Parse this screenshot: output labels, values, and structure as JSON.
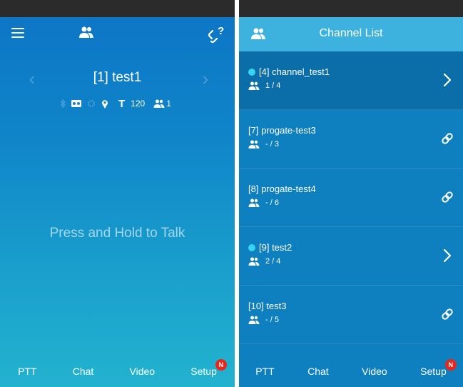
{
  "left_screen": {
    "channel_title": "[1] test1",
    "nav_prev": "‹",
    "nav_next": "›",
    "status": {
      "signal_value": "120",
      "member_count": "1"
    },
    "ptt_prompt": "Press and Hold to Talk",
    "bottom_nav": [
      {
        "label": "PTT"
      },
      {
        "label": "Chat"
      },
      {
        "label": "Video"
      },
      {
        "label": "Setup",
        "badge": "N"
      }
    ]
  },
  "right_screen": {
    "title": "Channel List",
    "channels": [
      {
        "name": "[4] channel_test1",
        "members": "1 / 4",
        "online": true,
        "action": "chevron-right-icon"
      },
      {
        "name": "[7] progate-test3",
        "members": "- / 3",
        "online": false,
        "action": "link-icon"
      },
      {
        "name": "[8] progate-test4",
        "members": "- / 6",
        "online": false,
        "action": "link-icon"
      },
      {
        "name": "[9] test2",
        "members": "2 / 4",
        "online": true,
        "action": "chevron-right-icon"
      },
      {
        "name": "[10] test3",
        "members": "- / 5",
        "online": false,
        "action": "link-icon"
      }
    ],
    "bottom_nav": [
      {
        "label": "PTT"
      },
      {
        "label": "Chat"
      },
      {
        "label": "Video"
      },
      {
        "label": "Setup",
        "badge": "N"
      }
    ]
  },
  "colors": {
    "left_bg_top": "#0d74c6",
    "left_bg_bottom": "#22b3cf",
    "right_bg": "#0e7fbf",
    "header_accent": "#3db2de",
    "online_dot": "#37d4f2",
    "badge": "#e8261c"
  }
}
